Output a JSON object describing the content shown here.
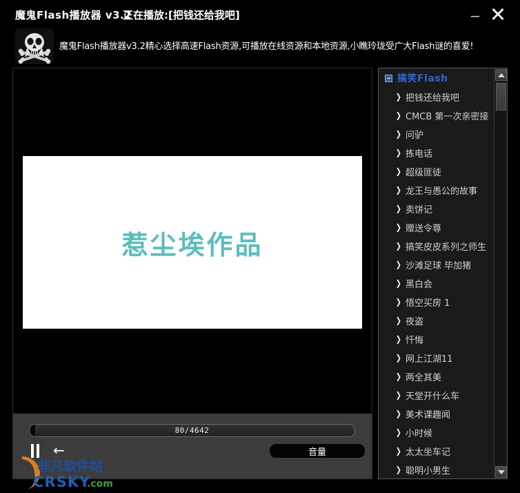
{
  "window": {
    "app_title": "魔鬼Flash播放器 v3.2",
    "now_playing": "正在播放:[把钱还给我吧]",
    "minimize_label": "–",
    "close_label": "✕"
  },
  "banner": {
    "description": "魔鬼Flash播放器v3.2精心选择高速Flash资源,可播放在线资源和本地资源,小瞧玲珑受广大Flash谜的喜爱!",
    "icon_name": "skull-logo-icon"
  },
  "player": {
    "flash_title": "惹尘埃作品",
    "flash_title_color": "#5cbdbd",
    "stage_background": "#000000",
    "canvas_background": "#ffffff",
    "progress": {
      "label": "80/4642",
      "current": 80,
      "total": 4642,
      "percent": 1.7
    },
    "controls": {
      "pause_label": "pause",
      "previous_label": "←",
      "volume_label": "音量"
    }
  },
  "playlist": {
    "root_label": "搞笑Flash",
    "root_color": "#3366cc",
    "items": [
      {
        "label": "把钱还给我吧"
      },
      {
        "label": "CMCB 第一次亲密接"
      },
      {
        "label": "问驴"
      },
      {
        "label": "拣电话"
      },
      {
        "label": "超级匪徒"
      },
      {
        "label": "龙王与愚公的故事"
      },
      {
        "label": "卖饼记"
      },
      {
        "label": "赠送令尊"
      },
      {
        "label": "搞笑皮皮系列之师生"
      },
      {
        "label": "沙滩足球 毕加猪"
      },
      {
        "label": "黑白会"
      },
      {
        "label": "悟空买房 1"
      },
      {
        "label": "夜盗"
      },
      {
        "label": "忏悔"
      },
      {
        "label": "网上江湖11"
      },
      {
        "label": "两全其美"
      },
      {
        "label": "天堂开什么车"
      },
      {
        "label": "美术课趣闻"
      },
      {
        "label": "小时候"
      },
      {
        "label": "太太坐车记"
      },
      {
        "label": "聪明小男生"
      }
    ]
  },
  "watermark": {
    "site_name": "非凡软件站",
    "site_url": "CRSKY.com"
  }
}
